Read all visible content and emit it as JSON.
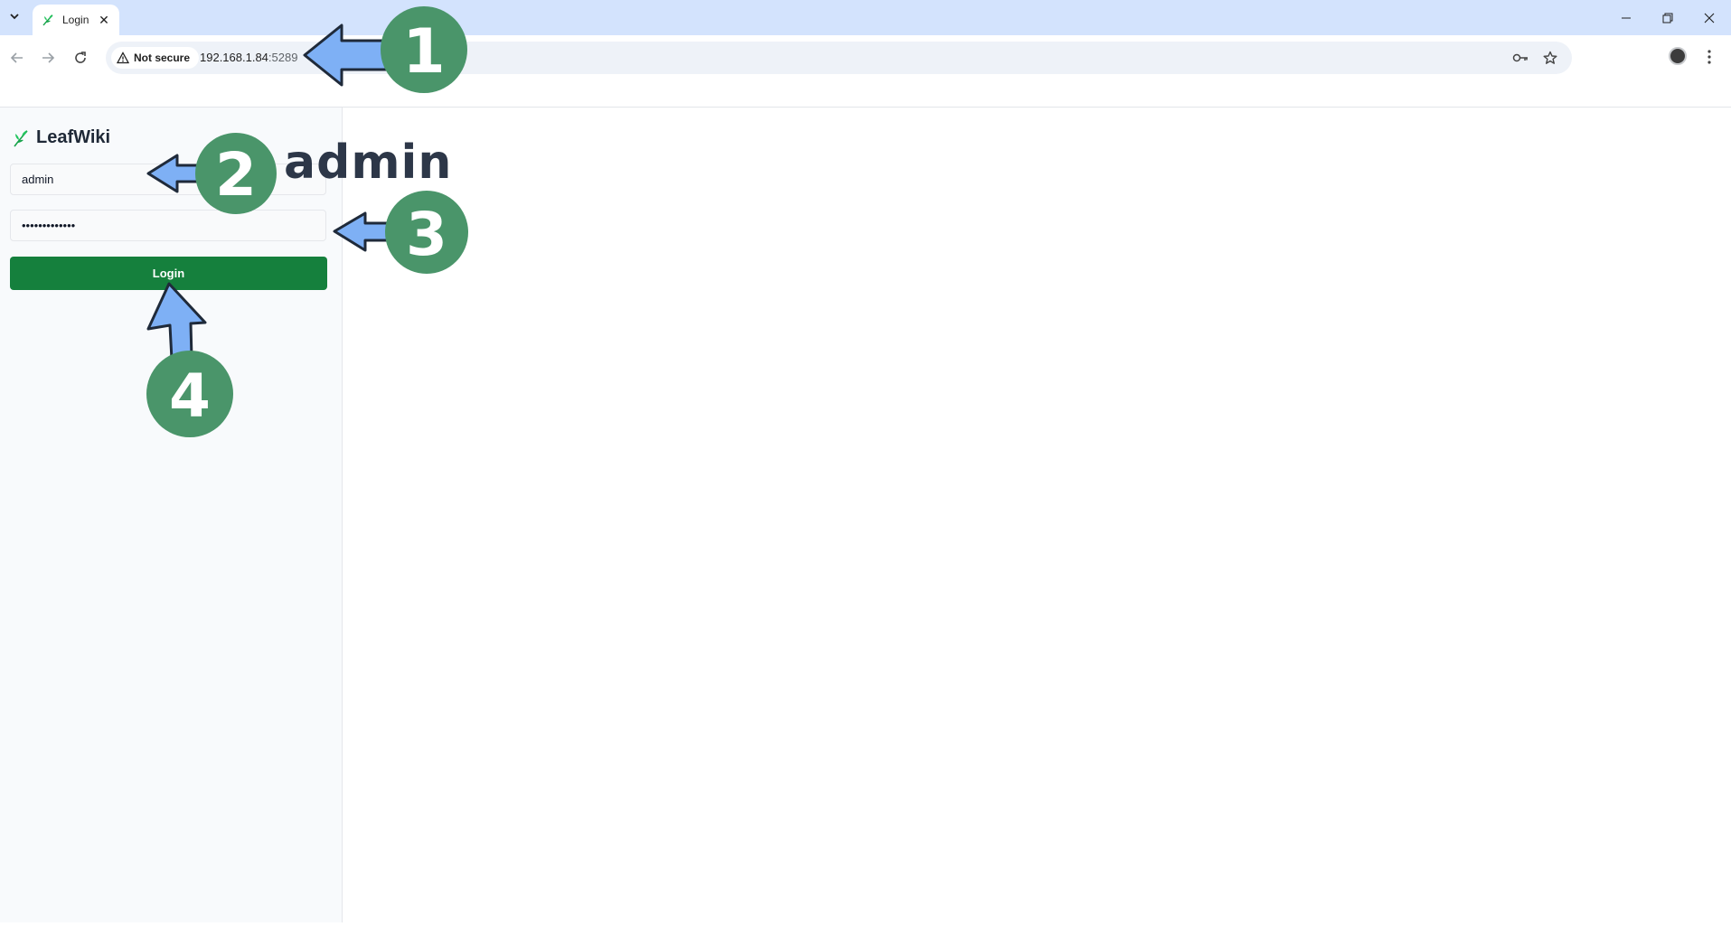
{
  "browser": {
    "tab": {
      "title": "Login"
    },
    "address": {
      "security_label": "Not secure",
      "host": "192.168.1.84",
      "port": ":5289"
    }
  },
  "page": {
    "brand": "LeafWiki",
    "username": {
      "value": "admin"
    },
    "password": {
      "value": "•••••••••••••"
    },
    "login_label": "Login"
  },
  "annotations": {
    "callout_text": "admin",
    "steps": [
      "1",
      "2",
      "3",
      "4"
    ],
    "circle_color": "#4a956a",
    "arrow_color": "#7eb0f5"
  }
}
